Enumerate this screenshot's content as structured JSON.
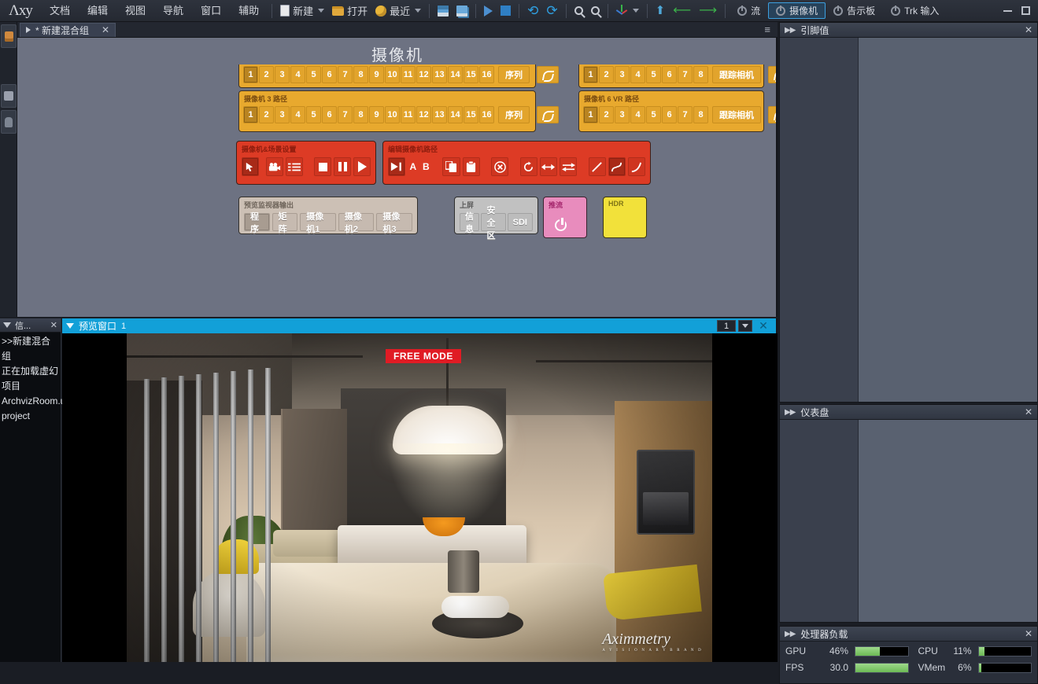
{
  "app": {
    "logo": "Λxy",
    "menus": [
      "文档",
      "编辑",
      "视图",
      "导航",
      "窗口",
      "辅助"
    ],
    "toolbar": {
      "new_label": "新建",
      "open_label": "打开",
      "recent_label": "最近",
      "save_icon": "save-icon",
      "save_all_icon": "save-all-icon",
      "play_icon": "play-icon",
      "stop_icon": "stop-icon",
      "undo_icon": "undo-icon",
      "redo_icon": "redo-icon",
      "zoom_in_icon": "zoom-in-icon",
      "zoom_out_icon": "zoom-out-icon",
      "axis_icon": "axis-icon",
      "up_level_icon": "up-level-icon",
      "back_icon": "back-arrow-icon",
      "forward_icon": "forward-arrow-icon"
    },
    "modes": [
      {
        "label": "流",
        "active": false
      },
      {
        "label": "摄像机",
        "active": true
      },
      {
        "label": "告示板",
        "active": false
      },
      {
        "label": "Trk 输入",
        "active": false
      }
    ],
    "window_controls": {
      "minimize": "minimize-icon",
      "maximize": "maximize-icon"
    }
  },
  "tabstrip": {
    "tab_label": "* 新建混合组",
    "close": "✕",
    "menu": "≡"
  },
  "canvas": {
    "title": "摄像机",
    "panels": {
      "cam_path_top": {
        "keys": [
          "1",
          "2",
          "3",
          "4",
          "5",
          "6",
          "7",
          "8",
          "9",
          "10",
          "11",
          "12",
          "13",
          "14",
          "15",
          "16"
        ],
        "sequence_label": "序列",
        "curve_icon": "curve-icon"
      },
      "cam3_path": {
        "title": "摄像机 3 路径",
        "keys": [
          "1",
          "2",
          "3",
          "4",
          "5",
          "6",
          "7",
          "8",
          "9",
          "10",
          "11",
          "12",
          "13",
          "14",
          "15",
          "16"
        ],
        "sequence_label": "序列",
        "curve_icon": "curve-icon"
      },
      "track_cam_top": {
        "keys": [
          "1",
          "2",
          "3",
          "4",
          "5",
          "6",
          "7",
          "8"
        ],
        "track_label": "跟踪相机",
        "curve_icon": "curve-icon"
      },
      "cam6_vr_path": {
        "title": "摄像机 6 VR 路径",
        "keys": [
          "1",
          "2",
          "3",
          "4",
          "5",
          "6",
          "7",
          "8"
        ],
        "track_label": "跟踪相机",
        "curve_icon": "curve-icon"
      },
      "cam_scene_setup": {
        "title": "摄像机&场景设置",
        "buttons": [
          {
            "name": "mouse-pointer-icon",
            "selected": true
          },
          {
            "name": "camera-icon",
            "selected": false
          },
          {
            "name": "list-icon",
            "selected": false
          },
          {
            "name": "stop-icon",
            "selected": false
          },
          {
            "name": "pause-icon",
            "selected": false
          },
          {
            "name": "play-icon",
            "selected": false
          }
        ]
      },
      "edit_cam_path": {
        "title": "编辑摄像机路径",
        "buttons": [
          {
            "name": "play-to-icon",
            "label": "",
            "selected": true
          },
          {
            "name": "point-a-label",
            "label": "A",
            "selected": false
          },
          {
            "name": "point-b-label",
            "label": "B",
            "selected": false
          },
          {
            "name": "copy-icon",
            "label": "",
            "selected": false
          },
          {
            "name": "paste-icon",
            "label": "",
            "selected": false
          },
          {
            "name": "delete-icon",
            "label": "",
            "selected": false
          },
          {
            "name": "loop-icon",
            "label": "",
            "selected": false
          },
          {
            "name": "mirror-icon",
            "label": "",
            "selected": false
          },
          {
            "name": "swap-icon",
            "label": "",
            "selected": false
          },
          {
            "name": "linear-icon",
            "label": "",
            "selected": false
          },
          {
            "name": "smooth-icon",
            "label": "",
            "selected": true
          },
          {
            "name": "ease-icon",
            "label": "",
            "selected": false
          }
        ]
      },
      "preview_output": {
        "title": "预览监视器输出",
        "buttons": [
          {
            "label": "程序",
            "selected": true
          },
          {
            "label": "矩阵",
            "selected": false
          },
          {
            "label": "摄像机1",
            "selected": false
          },
          {
            "label": "摄像机2",
            "selected": false
          },
          {
            "label": "摄像机3",
            "selected": false
          }
        ]
      },
      "on_air": {
        "title": "上屏",
        "buttons": [
          {
            "label": "信息"
          },
          {
            "label": "安全区"
          },
          {
            "label": "SDI"
          }
        ]
      },
      "stream": {
        "title": "推流",
        "power_icon": "power-icon"
      },
      "hdr": {
        "title": "HDR"
      }
    }
  },
  "log": {
    "title": "信...",
    "close": "✕",
    "lines": [
      ">>新建混合组",
      "正在加载虚幻",
      "项目",
      "ArchvizRoom.u",
      "project"
    ]
  },
  "preview": {
    "title": "预览窗口",
    "index": "1",
    "selector_value": "1",
    "badge": "FREE MODE",
    "watermark": "Aximmetry",
    "watermark_sub": "A Y I S I O N A R Y  B R A N D",
    "close": "✕"
  },
  "right_dock": {
    "pin_values": {
      "title": "引脚值",
      "close": "✕"
    },
    "dashboard": {
      "title": "仪表盘",
      "close": "✕"
    },
    "processor_load": {
      "title": "处理器负载",
      "close": "✕",
      "rows": [
        {
          "name": "GPU",
          "value": "46%",
          "percent": 46
        },
        {
          "name": "CPU",
          "value": "11%",
          "percent": 11
        },
        {
          "name": "FPS",
          "value": "30.0",
          "percent": 100
        },
        {
          "name": "VMem",
          "value": "6%",
          "percent": 6
        }
      ]
    }
  },
  "colors": {
    "accent": "#12a0d8",
    "orange_panel": "#e8a92e",
    "red_panel": "#dd3b25",
    "pink_panel": "#e88cbd",
    "yellow_panel": "#f2e13a",
    "badge_red": "#e01b24",
    "bar_green": "#6cba55"
  }
}
